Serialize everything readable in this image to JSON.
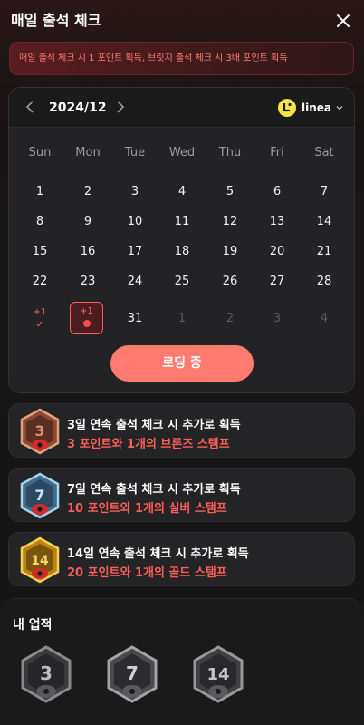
{
  "header": {
    "title": "매일 출석 체크"
  },
  "notice": {
    "text": "매일 출석 체크 시 1 포인트 획득, 브릿지 출석 체크 시 3배 포인트 획득"
  },
  "calendar": {
    "month": "2024/12",
    "chain": "linea",
    "weekdays": [
      "Sun",
      "Mon",
      "Tue",
      "Wed",
      "Thu",
      "Fri",
      "Sat"
    ],
    "weeks": [
      [
        "1",
        "2",
        "3",
        "4",
        "5",
        "6",
        "7"
      ],
      [
        "8",
        "9",
        "10",
        "11",
        "12",
        "13",
        "14"
      ],
      [
        "15",
        "16",
        "17",
        "18",
        "19",
        "20",
        "21"
      ],
      [
        "22",
        "23",
        "24",
        "25",
        "26",
        "27",
        "28"
      ]
    ],
    "last_week": {
      "checked": {
        "reward": "+1",
        "mark": "✓"
      },
      "today": {
        "reward": "+1"
      },
      "day_31": "31",
      "next_month": [
        "1",
        "2",
        "3",
        "4"
      ]
    },
    "button_label": "로딩 중"
  },
  "streaks": [
    {
      "days": "3",
      "title_rest": "일 연속 출석 체크 시 추가로 획득",
      "points": "3",
      "reward_rest": " 포인트와 1개의 브론즈 스탬프",
      "tier": "bronze"
    },
    {
      "days": "7",
      "title_rest": "일 연속 출석 체크 시 추가로 획득",
      "points": "10",
      "reward_rest": " 포인트와 1개의 실버 스탬프",
      "tier": "silver"
    },
    {
      "days": "14",
      "title_rest": "일 연속 출석 체크 시 추가로 획득",
      "points": "20",
      "reward_rest": " 포인트와 1개의 골드 스탬프",
      "tier": "gold"
    }
  ],
  "achievements": {
    "title": "내 업적",
    "badges": [
      {
        "label": "3",
        "icon": "bronze-stamp-locked-icon"
      },
      {
        "label": "7",
        "icon": "silver-stamp-locked-icon"
      },
      {
        "label": "14",
        "icon": "gold-stamp-locked-icon"
      }
    ]
  },
  "colors": {
    "accent": "#ff5e57",
    "button": "#ff7b72",
    "bronze": "#b86a4a",
    "silver": "#6f9fc0",
    "gold": "#e0a51e"
  }
}
